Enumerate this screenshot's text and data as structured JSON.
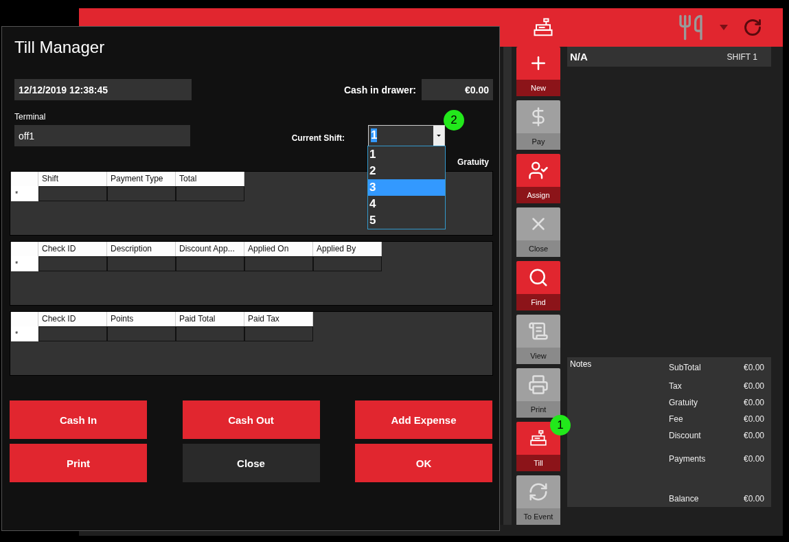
{
  "app": {
    "sidebar": [
      {
        "label": "New",
        "kind": "red"
      },
      {
        "label": "Pay",
        "kind": "gray"
      },
      {
        "label": "Assign",
        "kind": "red"
      },
      {
        "label": "Close",
        "kind": "gray"
      },
      {
        "label": "Find",
        "kind": "red"
      },
      {
        "label": "View",
        "kind": "gray"
      },
      {
        "label": "Print",
        "kind": "gray"
      },
      {
        "label": "Till",
        "kind": "red",
        "badge": "1"
      },
      {
        "label": "To Event",
        "kind": "gray"
      }
    ],
    "check": {
      "name": "N/A",
      "shift": "SHIFT 1"
    },
    "notes_label": "Notes",
    "totals": [
      {
        "label": "SubTotal",
        "value": "€0.00"
      },
      {
        "label": "Tax",
        "value": "€0.00"
      },
      {
        "label": "Gratuity",
        "value": "€0.00"
      },
      {
        "label": "Fee",
        "value": "€0.00"
      },
      {
        "label": "Discount",
        "value": "€0.00"
      },
      {
        "label": "Payments",
        "value": "€0.00"
      },
      {
        "label": "Balance",
        "value": "€0.00"
      }
    ]
  },
  "dialog": {
    "title": "Till Manager",
    "datetime": "12/12/2019 12:38:45",
    "cash_label": "Cash in drawer:",
    "cash_value": "€0.00",
    "terminal_label": "Terminal",
    "terminal_value": "off1",
    "shift_label": "Current Shift:",
    "shift_value": "1",
    "shift_badge": "2",
    "shift_options": [
      {
        "label": "1",
        "selected": false
      },
      {
        "label": "2",
        "selected": false
      },
      {
        "label": "3",
        "selected": true
      },
      {
        "label": "4",
        "selected": false
      },
      {
        "label": "5",
        "selected": false
      }
    ],
    "gratuity_label": "Gratuity",
    "grids": [
      {
        "columns": [
          "Shift",
          "Payment Type",
          "Total"
        ],
        "new_row": "*"
      },
      {
        "columns": [
          "Check ID",
          "Description",
          "Discount App...",
          "Applied On",
          "Applied By"
        ],
        "new_row": "*"
      },
      {
        "columns": [
          "Check ID",
          "Points",
          "Paid Total",
          "Paid Tax"
        ],
        "new_row": "*"
      }
    ],
    "buttons": [
      {
        "label": "Cash In",
        "kind": "red"
      },
      {
        "label": "Cash Out",
        "kind": "red"
      },
      {
        "label": "Add Expense",
        "kind": "red"
      },
      {
        "label": "Print",
        "kind": "red"
      },
      {
        "label": "Close",
        "kind": "dark"
      },
      {
        "label": "OK",
        "kind": "red"
      }
    ]
  }
}
